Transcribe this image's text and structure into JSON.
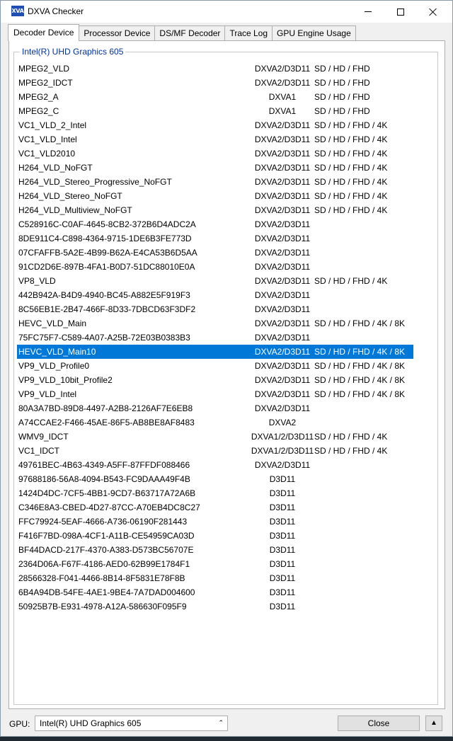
{
  "window": {
    "app_icon": "XVA",
    "title": "DXVA Checker"
  },
  "tabs": [
    {
      "label": "Decoder Device",
      "active": true
    },
    {
      "label": "Processor Device",
      "active": false
    },
    {
      "label": "DS/MF Decoder",
      "active": false
    },
    {
      "label": "Trace Log",
      "active": false
    },
    {
      "label": "GPU Engine Usage",
      "active": false
    }
  ],
  "group_label": "Intel(R) UHD Graphics 605",
  "decoders": [
    {
      "name": "MPEG2_VLD",
      "api": "DXVA2/D3D11",
      "res": "SD / HD / FHD"
    },
    {
      "name": "MPEG2_IDCT",
      "api": "DXVA2/D3D11",
      "res": "SD / HD / FHD"
    },
    {
      "name": "MPEG2_A",
      "api": "DXVA1",
      "res": "SD / HD / FHD"
    },
    {
      "name": "MPEG2_C",
      "api": "DXVA1",
      "res": "SD / HD / FHD"
    },
    {
      "name": "VC1_VLD_2_Intel",
      "api": "DXVA2/D3D11",
      "res": "SD / HD / FHD / 4K"
    },
    {
      "name": "VC1_VLD_Intel",
      "api": "DXVA2/D3D11",
      "res": "SD / HD / FHD / 4K"
    },
    {
      "name": "VC1_VLD2010",
      "api": "DXVA2/D3D11",
      "res": "SD / HD / FHD / 4K"
    },
    {
      "name": "H264_VLD_NoFGT",
      "api": "DXVA2/D3D11",
      "res": "SD / HD / FHD / 4K"
    },
    {
      "name": "H264_VLD_Stereo_Progressive_NoFGT",
      "api": "DXVA2/D3D11",
      "res": "SD / HD / FHD / 4K"
    },
    {
      "name": "H264_VLD_Stereo_NoFGT",
      "api": "DXVA2/D3D11",
      "res": "SD / HD / FHD / 4K"
    },
    {
      "name": "H264_VLD_Multiview_NoFGT",
      "api": "DXVA2/D3D11",
      "res": "SD / HD / FHD / 4K"
    },
    {
      "name": "C528916C-C0AF-4645-8CB2-372B6D4ADC2A",
      "api": "DXVA2/D3D11",
      "res": ""
    },
    {
      "name": "8DE911C4-C898-4364-9715-1DE6B3FE773D",
      "api": "DXVA2/D3D11",
      "res": ""
    },
    {
      "name": "07CFAFFB-5A2E-4B99-B62A-E4CA53B6D5AA",
      "api": "DXVA2/D3D11",
      "res": ""
    },
    {
      "name": "91CD2D6E-897B-4FA1-B0D7-51DC88010E0A",
      "api": "DXVA2/D3D11",
      "res": ""
    },
    {
      "name": "VP8_VLD",
      "api": "DXVA2/D3D11",
      "res": "SD / HD / FHD / 4K"
    },
    {
      "name": "442B942A-B4D9-4940-BC45-A882E5F919F3",
      "api": "DXVA2/D3D11",
      "res": ""
    },
    {
      "name": "8C56EB1E-2B47-466F-8D33-7DBCD63F3DF2",
      "api": "DXVA2/D3D11",
      "res": ""
    },
    {
      "name": "HEVC_VLD_Main",
      "api": "DXVA2/D3D11",
      "res": "SD / HD / FHD / 4K / 8K"
    },
    {
      "name": "75FC75F7-C589-4A07-A25B-72E03B0383B3",
      "api": "DXVA2/D3D11",
      "res": ""
    },
    {
      "name": "HEVC_VLD_Main10",
      "api": "DXVA2/D3D11",
      "res": "SD / HD / FHD / 4K / 8K",
      "selected": true
    },
    {
      "name": "VP9_VLD_Profile0",
      "api": "DXVA2/D3D11",
      "res": "SD / HD / FHD / 4K / 8K"
    },
    {
      "name": "VP9_VLD_10bit_Profile2",
      "api": "DXVA2/D3D11",
      "res": "SD / HD / FHD / 4K / 8K"
    },
    {
      "name": "VP9_VLD_Intel",
      "api": "DXVA2/D3D11",
      "res": "SD / HD / FHD / 4K / 8K"
    },
    {
      "name": "80A3A7BD-89D8-4497-A2B8-2126AF7E6EB8",
      "api": "DXVA2/D3D11",
      "res": ""
    },
    {
      "name": "A74CCAE2-F466-45AE-86F5-AB8BE8AF8483",
      "api": "DXVA2",
      "res": ""
    },
    {
      "name": "WMV9_IDCT",
      "api": "DXVA1/2/D3D11",
      "res": "SD / HD / FHD / 4K"
    },
    {
      "name": "VC1_IDCT",
      "api": "DXVA1/2/D3D11",
      "res": "SD / HD / FHD / 4K"
    },
    {
      "name": "49761BEC-4B63-4349-A5FF-87FFDF088466",
      "api": "DXVA2/D3D11",
      "res": ""
    },
    {
      "name": "97688186-56A8-4094-B543-FC9DAAA49F4B",
      "api": "D3D11",
      "res": ""
    },
    {
      "name": "1424D4DC-7CF5-4BB1-9CD7-B63717A72A6B",
      "api": "D3D11",
      "res": ""
    },
    {
      "name": "C346E8A3-CBED-4D27-87CC-A70EB4DC8C27",
      "api": "D3D11",
      "res": ""
    },
    {
      "name": "FFC79924-5EAF-4666-A736-06190F281443",
      "api": "D3D11",
      "res": ""
    },
    {
      "name": "F416F7BD-098A-4CF1-A11B-CE54959CA03D",
      "api": "D3D11",
      "res": ""
    },
    {
      "name": "BF44DACD-217F-4370-A383-D573BC56707E",
      "api": "D3D11",
      "res": ""
    },
    {
      "name": "2364D06A-F67F-4186-AED0-62B99E1784F1",
      "api": "D3D11",
      "res": ""
    },
    {
      "name": "28566328-F041-4466-8B14-8F5831E78F8B",
      "api": "D3D11",
      "res": ""
    },
    {
      "name": "6B4A94DB-54FE-4AE1-9BE4-7A7DAD004600",
      "api": "D3D11",
      "res": ""
    },
    {
      "name": "50925B7B-E931-4978-A12A-586630F095F9",
      "api": "D3D11",
      "res": ""
    }
  ],
  "footer": {
    "gpu_label": "GPU:",
    "gpu_value": "Intel(R) UHD Graphics 605",
    "close_label": "Close",
    "up_glyph": "▲"
  },
  "colors": {
    "selection": "#0078d7",
    "group_label": "#003399"
  }
}
